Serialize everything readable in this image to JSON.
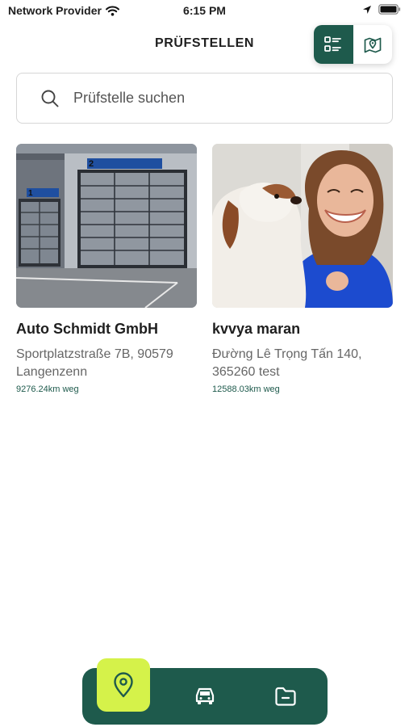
{
  "status_bar": {
    "carrier": "Network Provider",
    "time": "6:15 PM"
  },
  "header": {
    "title": "PRÜFSTELLEN",
    "view_toggle": {
      "options": [
        "list-icon",
        "map-icon"
      ],
      "active": "list-icon"
    }
  },
  "search": {
    "placeholder": "Prüfstelle suchen",
    "value": ""
  },
  "stations": [
    {
      "name": "Auto Schmidt GmbH",
      "address": "Sportplatzstraße 7B, 90579 Langenzenn",
      "distance": "9276.24km weg",
      "image": "garage-photo",
      "image_sign_labels": [
        "2",
        "1"
      ]
    },
    {
      "name": "kvvya maran",
      "address": "Đường Lê Trọng Tấn 140, 365260 test",
      "distance": "12588.03km weg",
      "image": "woman-with-dog-photo"
    }
  ],
  "bottom_nav": {
    "items": [
      "location-pin-icon",
      "car-icon",
      "folder-icon"
    ],
    "active": "location-pin-icon"
  },
  "colors": {
    "primary": "#1e5a4c",
    "accent": "#d5f24a",
    "distance_text": "#1e5a4c"
  }
}
